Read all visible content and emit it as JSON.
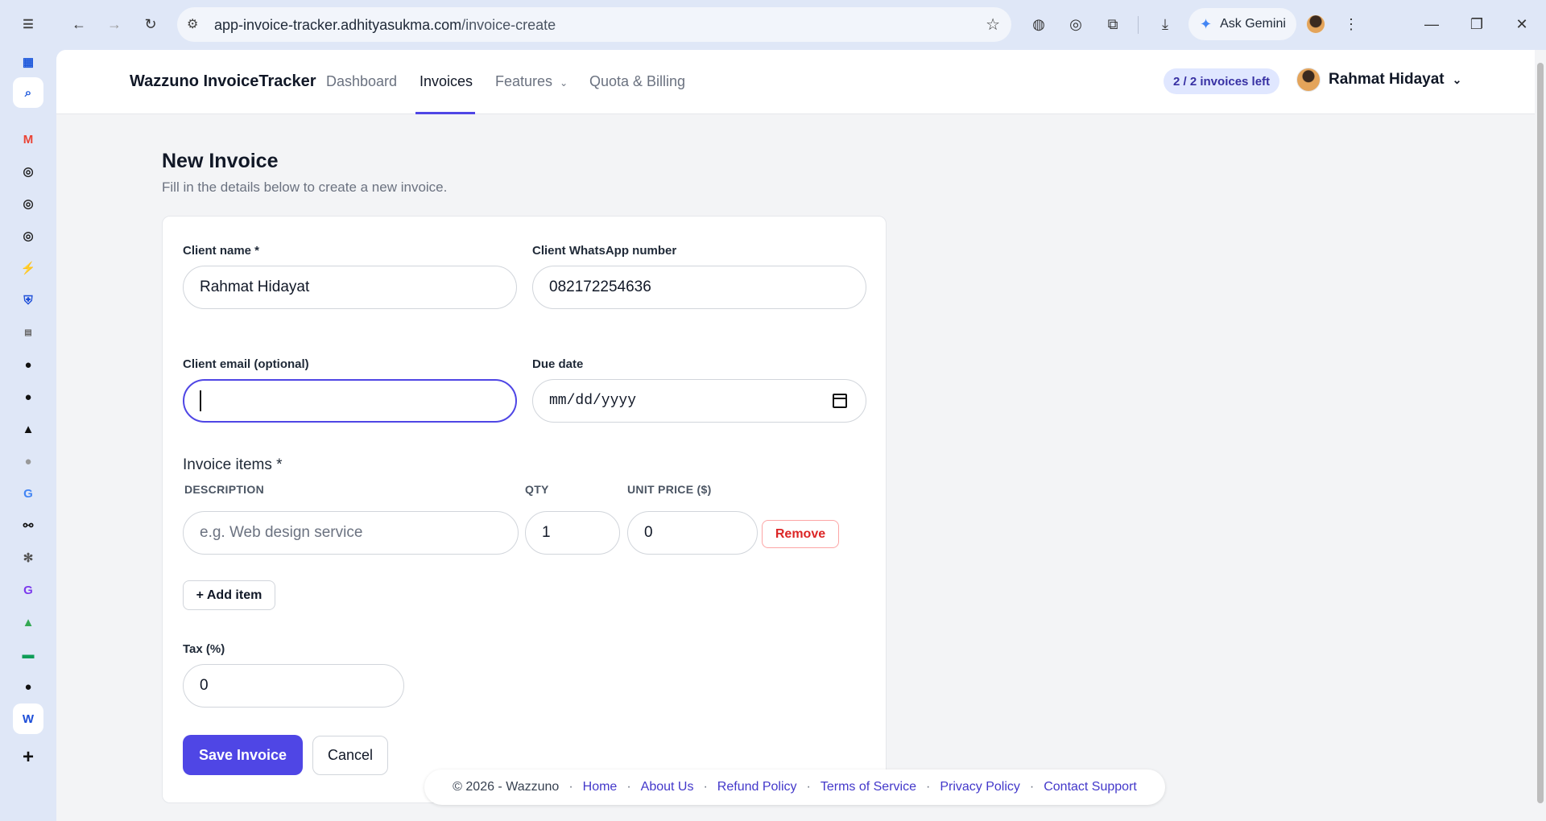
{
  "browser": {
    "url_host": "app-invoice-tracker.adhityasukma.com",
    "url_path": "/invoice-create",
    "gemini_label": "Ask Gemini"
  },
  "app": {
    "brand": "Wazzuno InvoiceTracker",
    "nav": [
      "Dashboard",
      "Invoices",
      "Features",
      "Quota & Billing"
    ],
    "active_nav": "Invoices",
    "quota_badge": "2 / 2 invoices left",
    "user_name": "Rahmat Hidayat"
  },
  "page": {
    "title": "New Invoice",
    "subtitle": "Fill in the details below to create a new invoice."
  },
  "form": {
    "client_name_label": "Client name *",
    "client_name_value": "Rahmat Hidayat",
    "whatsapp_label": "Client WhatsApp number",
    "whatsapp_value": "082172254636",
    "email_label": "Client email (optional)",
    "email_value": "",
    "due_date_label": "Due date",
    "due_date_placeholder": "mm/dd/yyyy",
    "items_label": "Invoice items *",
    "col_description": "DESCRIPTION",
    "col_qty": "QTY",
    "col_unit_price": "UNIT PRICE ($)",
    "item_description_placeholder": "e.g. Web design service",
    "item_qty": "1",
    "item_unit_price": "0",
    "remove_label": "Remove",
    "add_item_label": "+ Add item",
    "tax_label": "Tax (%)",
    "tax_value": "0",
    "save_label": "Save Invoice",
    "cancel_label": "Cancel"
  },
  "footer": {
    "copyright": "© 2026 - Wazzuno",
    "links": [
      "Home",
      "About Us",
      "Refund Policy",
      "Terms of Service",
      "Privacy Policy",
      "Contact Support"
    ]
  },
  "colors": {
    "accent": "#4f46e5",
    "remove": "#dc2626",
    "quota_bg": "#e0e7ff"
  }
}
